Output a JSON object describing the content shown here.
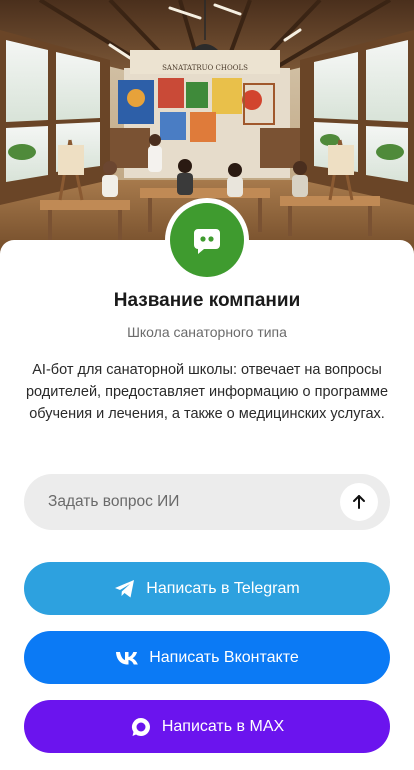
{
  "hero": {
    "sign_text": "SANATATRUO CHOOLS"
  },
  "company": {
    "name": "Название компании",
    "type": "Школа санаторного типа",
    "description": "AI-бот для санаторной школы: отвечает на вопросы родителей, предоставляет информацию о программе обучения и лечения, а также о медицинских услугах."
  },
  "ask": {
    "placeholder": "Задать вопрос ИИ"
  },
  "buttons": {
    "telegram": "Написать в Telegram",
    "vk": "Написать Вконтакте",
    "max": "Написать в MAX"
  },
  "icons": {
    "avatar": "chat-bot-icon",
    "send": "arrow-up-icon",
    "telegram": "telegram-icon",
    "vk": "vk-icon",
    "max": "max-icon"
  },
  "colors": {
    "avatar_bg": "#3f9b2f",
    "telegram": "#2da1df",
    "vk": "#0b7af5",
    "max": "#6b14ee"
  }
}
